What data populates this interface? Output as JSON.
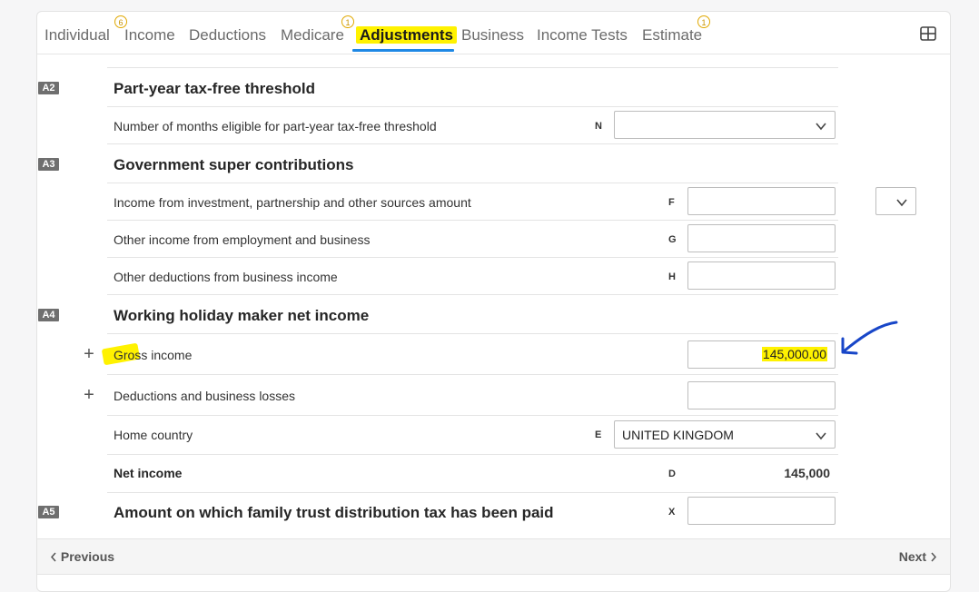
{
  "tabs": [
    {
      "label": "Individual",
      "badge": "6"
    },
    {
      "label": "Income",
      "badge": ""
    },
    {
      "label": "Deductions",
      "badge": ""
    },
    {
      "label": "Medicare",
      "badge": "1"
    },
    {
      "label": "Adjustments",
      "badge": "",
      "active": true
    },
    {
      "label": "Business",
      "badge": ""
    },
    {
      "label": "Income Tests",
      "badge": ""
    },
    {
      "label": "Estimate",
      "badge": "1"
    }
  ],
  "sections": {
    "a2": {
      "code": "A2",
      "title": "Part-year tax-free threshold",
      "months_label": "Number of months eligible for part-year tax-free threshold",
      "months_code": "N",
      "months_value": ""
    },
    "a3": {
      "code": "A3",
      "title": "Government super contributions",
      "investment_label": "Income from investment, partnership and other sources amount",
      "investment_code": "F",
      "employment_label": "Other income from employment and business",
      "employment_code": "G",
      "deductions_label": "Other deductions from business income",
      "deductions_code": "H"
    },
    "a4": {
      "code": "A4",
      "title": "Working holiday maker net income",
      "gross_label": "Gross income",
      "gross_value": "145,000.00",
      "losses_label": "Deductions and business losses",
      "country_label": "Home country",
      "country_code": "E",
      "country_value": "UNITED KINGDOM",
      "net_label": "Net income",
      "net_code": "D",
      "net_value": "145,000"
    },
    "a5": {
      "code": "A5",
      "title": "Amount on which family trust distribution tax has been paid",
      "field_code": "X"
    }
  },
  "footer": {
    "previous_label": "Previous",
    "next_label": "Next"
  },
  "colors": {
    "accent": "#1e88e5",
    "highlight": "#fff200",
    "badge": "#e0a800",
    "annotation_arrow": "#1846c8"
  },
  "icons": [
    "grid-view-icon",
    "chevron-down-icon",
    "plus-icon",
    "chevron-left-icon",
    "chevron-right-icon"
  ]
}
